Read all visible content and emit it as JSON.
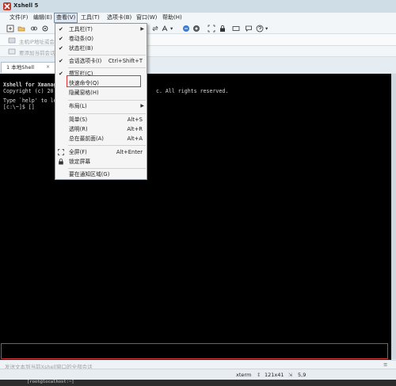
{
  "window": {
    "title": "Xshell 5"
  },
  "menu": [
    {
      "label": "文件(F)"
    },
    {
      "label": "编辑(E)"
    },
    {
      "label": "查看(V)"
    },
    {
      "label": "工具(T)"
    },
    {
      "label": "选项卡(B)"
    },
    {
      "label": "窗口(W)"
    },
    {
      "label": "帮助(H)"
    }
  ],
  "address": {
    "placeholder": "主机IP地址或会话名称"
  },
  "address2": {
    "text": "要添加当前会话"
  },
  "tab": {
    "label": "1 本地Shell",
    "close": "×"
  },
  "view_menu": {
    "items": [
      {
        "label": "工具栏(T)",
        "checked": true,
        "submenu": true
      },
      {
        "label": "卷动条(O)",
        "checked": true
      },
      {
        "label": "状态栏(B)",
        "checked": true
      },
      {
        "label": "会话选项卡(I)",
        "checked": true,
        "shortcut": "Ctrl+Shift+T"
      },
      {
        "label": "撰写栏(C)",
        "checked": true
      },
      {
        "label": "快速命令(Q)"
      },
      {
        "label": "隐藏窗格(H)"
      },
      {
        "label": "布局(L)",
        "submenu": true
      },
      {
        "label": "简单(S)",
        "shortcut": "Alt+S"
      },
      {
        "label": "透明(R)",
        "shortcut": "Alt+R"
      },
      {
        "label": "总在最前面(A)",
        "shortcut": "Alt+A"
      },
      {
        "label": "全屏(F)",
        "shortcut": "Alt+Enter",
        "icon": "fullscreen-icon"
      },
      {
        "label": "锁定屏幕",
        "icon": "lock-icon"
      },
      {
        "label": "要在通知区域(G)"
      }
    ],
    "check_glyph": "✔",
    "arrow_glyph": "▶"
  },
  "terminal": {
    "lines": [
      "Xshell for Xmanag",
      "Copyright (c) 20",
      "",
      "Type `help' to le",
      "[c:\\~]$ []"
    ],
    "line_right": "c. All rights reserved."
  },
  "hint": {
    "text": "发送文本到当前Xshell窗口的全部会话"
  },
  "status": {
    "term": "xterm",
    "size": "121x41",
    "pos": "5,9"
  },
  "bottom": {
    "text": "[root@localhost:~]"
  },
  "colors": {
    "highlight": "#dd3333",
    "terminal_bg": "#000000",
    "menu_active": "#dfe8f2"
  }
}
